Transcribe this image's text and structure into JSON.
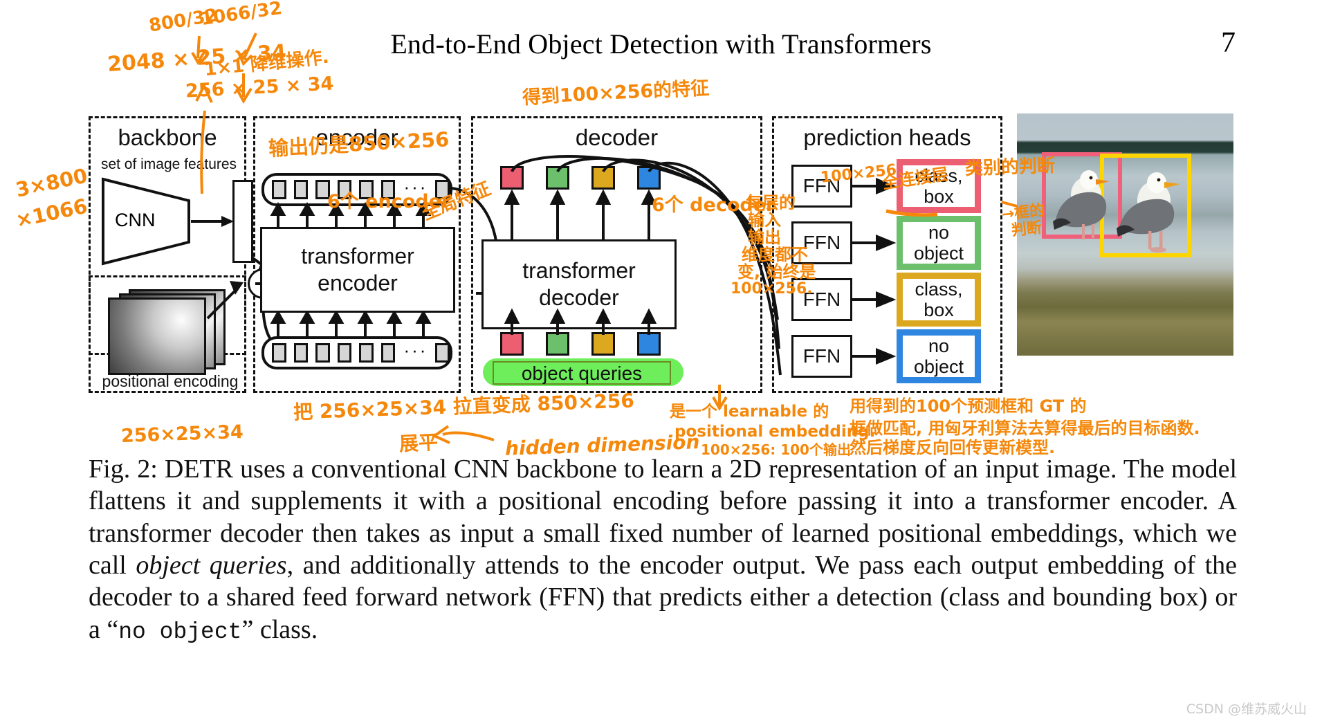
{
  "header": {
    "title": "End-to-End Object Detection with Transformers",
    "page_number": "7"
  },
  "figure": {
    "sections": [
      {
        "name": "backbone",
        "sub": "set of image features"
      },
      {
        "name": "encoder",
        "sub": ""
      },
      {
        "name": "decoder",
        "sub": ""
      },
      {
        "name": "prediction heads",
        "sub": ""
      }
    ],
    "cnn_label": "CNN",
    "positional_encoding_label": "positional encoding",
    "transformer_encoder_label_1": "transformer",
    "transformer_encoder_label_2": "encoder",
    "transformer_decoder_label_1": "transformer",
    "transformer_decoder_label_2": "decoder",
    "object_queries_label": "object queries",
    "plus_symbol": "+",
    "token_dots": "···",
    "ffn_label": "FFN",
    "prediction_boxes": [
      {
        "line1": "class,",
        "line2": "box",
        "color": "#EC5E71"
      },
      {
        "line1": "no",
        "line2": "object",
        "color": "#6CC06C"
      },
      {
        "line1": "class,",
        "line2": "box",
        "color": "#DCA81F"
      },
      {
        "line1": "no",
        "line2": "object",
        "color": "#2F86E0"
      }
    ],
    "query_colors": [
      "#EC5E71",
      "#6CC06C",
      "#DCA81F",
      "#2F86E0"
    ],
    "photo": {
      "description": "two seagulls standing on a rock by the sea",
      "boxes": [
        {
          "color": "#F0607A",
          "name": "pink-bounding-box"
        },
        {
          "color": "#FFD500",
          "name": "yellow-bounding-box"
        }
      ]
    }
  },
  "annotations": {
    "color": "#F5880B",
    "a_800_32": "800/32",
    "a_1066_32": "1066/32",
    "a_2048": "2048 × 25 × 34",
    "a_1x1": "1×1 降维操作.",
    "a_256_top": "256 × 25 × 34",
    "a_3x800": "3×800",
    "a_x1066": "×1066",
    "a_enc_out": "输出仍是850×256",
    "a_6enc": "6个 encoder",
    "a_global": "全局特征",
    "a_dec_top": "得到100×256的特征",
    "a_6dec": "6个 decoder",
    "a_dec_note_1": "每层的",
    "a_dec_note_2": "输入",
    "a_dec_note_3": "输出",
    "a_dec_note_4": "维度都不",
    "a_dec_note_5": "变, 始终是",
    "a_dec_note_6": "100×256.",
    "a_100x256": "100×256",
    "a_fc": "全连接层",
    "a_class_judge": "类别的判断",
    "a_box_judge_1": "→框的",
    "a_box_judge_2": "判断",
    "a_256_bottom": "256×25×34",
    "a_flatten_line": "把 256×25×34 拉直变成 850×256",
    "a_flatten_word": "展平",
    "a_hidden_dim": "hidden dimension",
    "a_oq_1": "是一个 learnable 的",
    "a_oq_2": "positional embedding.",
    "a_oq_3": "100×256: 100个输出",
    "a_match_1": "用得到的100个预测框和 GT 的",
    "a_match_2": "框做匹配, 用匈牙利算法去算得最后的目标函数.",
    "a_match_3": "然后梯度反向回传更新模型."
  },
  "caption": {
    "prefix": "Fig. 2: ",
    "text_1": "DETR uses a conventional CNN backbone to learn a 2D representation of an input image. The model flattens it and supplements it with a positional encoding before passing it into a transformer encoder. A transformer decoder then takes as input a small fixed number of learned positional embeddings, which we call ",
    "italic": "object queries",
    "text_2": ", and additionally attends to the encoder output. We pass each output embedding of the decoder to a shared feed forward network (FFN) that predicts either a detection (class and bounding box) or a “",
    "mono": "no object",
    "text_3": "” class."
  },
  "watermark": "CSDN @维苏威火山"
}
